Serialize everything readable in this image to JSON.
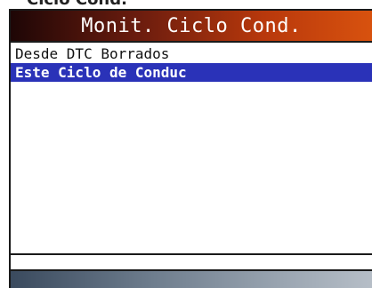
{
  "header_partial": "Ciclo Cond.",
  "title": "Monit. Ciclo Cond.",
  "menu": {
    "items": [
      {
        "label": "Desde DTC Borrados",
        "selected": false
      },
      {
        "label": "Este Ciclo de Conduc",
        "selected": true
      }
    ]
  },
  "colors": {
    "selection": "#2a32b8",
    "title_bar_start": "#1e0606",
    "title_bar_end": "#d8520e",
    "bottom_bar_start": "#3a4a5e",
    "bottom_bar_end": "#b6bec7"
  }
}
